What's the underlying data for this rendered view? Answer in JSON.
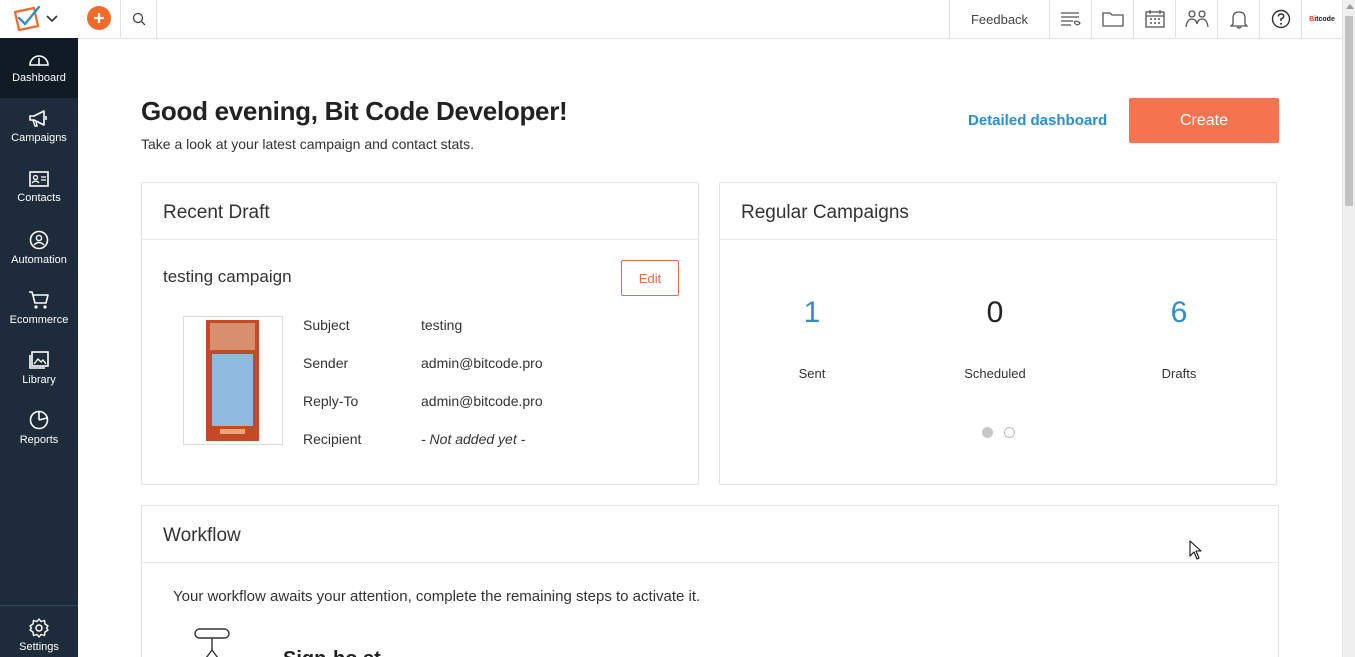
{
  "topbar": {
    "feedback_label": "Feedback",
    "brand_text_red": "B",
    "brand_text": "itcode",
    "icons": [
      "logo-icon",
      "chevron-down-icon",
      "plus-icon",
      "search-icon",
      "list-icon",
      "folder-icon",
      "calendar-icon",
      "users-icon",
      "bell-icon",
      "help-icon"
    ]
  },
  "sidebar": {
    "items": [
      {
        "label": "Dashboard",
        "icon": "gauge-icon",
        "active": true
      },
      {
        "label": "Campaigns",
        "icon": "megaphone-icon"
      },
      {
        "label": "Contacts",
        "icon": "contact-card-icon"
      },
      {
        "label": "Automation",
        "icon": "automation-icon"
      },
      {
        "label": "Ecommerce",
        "icon": "cart-icon"
      },
      {
        "label": "Library",
        "icon": "image-library-icon"
      },
      {
        "label": "Reports",
        "icon": "pie-chart-icon"
      }
    ],
    "settings_label": "Settings"
  },
  "header": {
    "greeting": "Good evening, Bit Code Developer!",
    "subtitle": "Take a look at your latest campaign and contact stats.",
    "detailed_link": "Detailed dashboard",
    "create_label": "Create"
  },
  "recent_draft": {
    "title": "Recent Draft",
    "campaign_name": "testing campaign",
    "edit_label": "Edit",
    "rows": [
      {
        "label": "Subject",
        "value": "testing"
      },
      {
        "label": "Sender",
        "value": "admin@bitcode.pro"
      },
      {
        "label": "Reply-To",
        "value": "admin@bitcode.pro"
      },
      {
        "label": "Recipient",
        "value": "- Not added yet -"
      }
    ]
  },
  "regular_campaigns": {
    "title": "Regular Campaigns",
    "stats": [
      {
        "value": "1",
        "label": "Sent",
        "color": "#2a8fd1"
      },
      {
        "value": "0",
        "label": "Scheduled",
        "color": "#222222"
      },
      {
        "value": "6",
        "label": "Drafts",
        "color": "#2a8fd1"
      }
    ],
    "pager_active": 1,
    "pager_total": 2
  },
  "workflow": {
    "title": "Workflow",
    "message": "Your workflow awaits your attention, complete the remaining steps to activate it.",
    "step_title": "Sign-ho st"
  },
  "colors": {
    "accent": "#f5734f",
    "link": "#2a8fd1",
    "sidebar": "#1d2b3a"
  }
}
